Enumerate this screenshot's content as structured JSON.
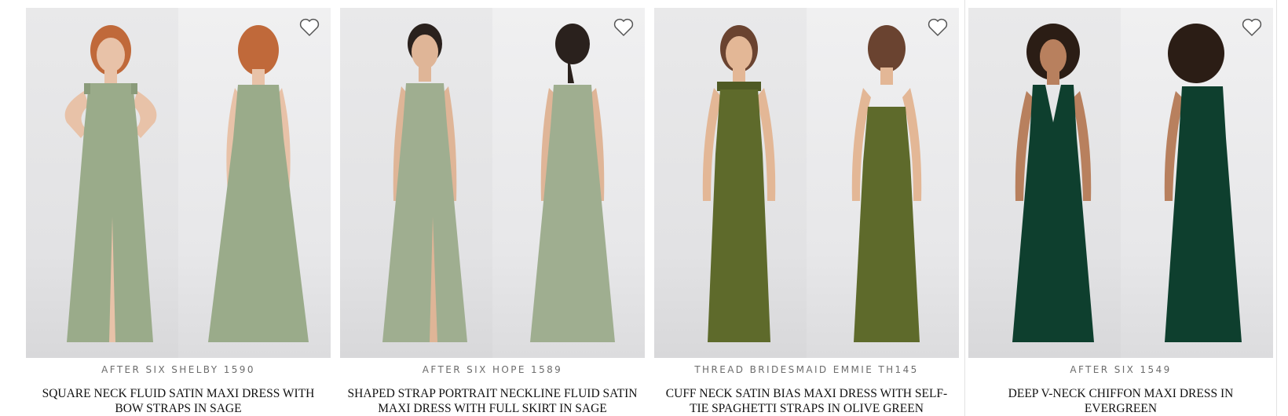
{
  "products": [
    {
      "brand": "AFTER SIX SHELBY 1590",
      "name": "SQUARE NECK FLUID SATIN MAXI DRESS WITH BOW STRAPS IN SAGE",
      "dress_color": "#9aab8a",
      "hair_color": "#c0693a"
    },
    {
      "brand": "AFTER SIX HOPE 1589",
      "name": "SHAPED STRAP PORTRAIT NECKLINE FLUID SATIN MAXI DRESS WITH FULL SKIRT IN SAGE",
      "dress_color": "#9fae90",
      "hair_color": "#2a211d"
    },
    {
      "brand": "THREAD BRIDESMAID EMMIE TH145",
      "name": "CUFF NECK SATIN BIAS MAXI DRESS WITH SELF-TIE SPAGHETTI STRAPS IN OLIVE GREEN",
      "dress_color": "#5e6a2b",
      "hair_color": "#6a4330"
    },
    {
      "brand": "AFTER SIX 1549",
      "name": "DEEP V-NECK CHIFFON MAXI DRESS IN EVERGREEN",
      "dress_color": "#0e3f2e",
      "hair_color": "#2b1d15"
    }
  ],
  "icons": {
    "favorite": "heart-outline-icon"
  }
}
